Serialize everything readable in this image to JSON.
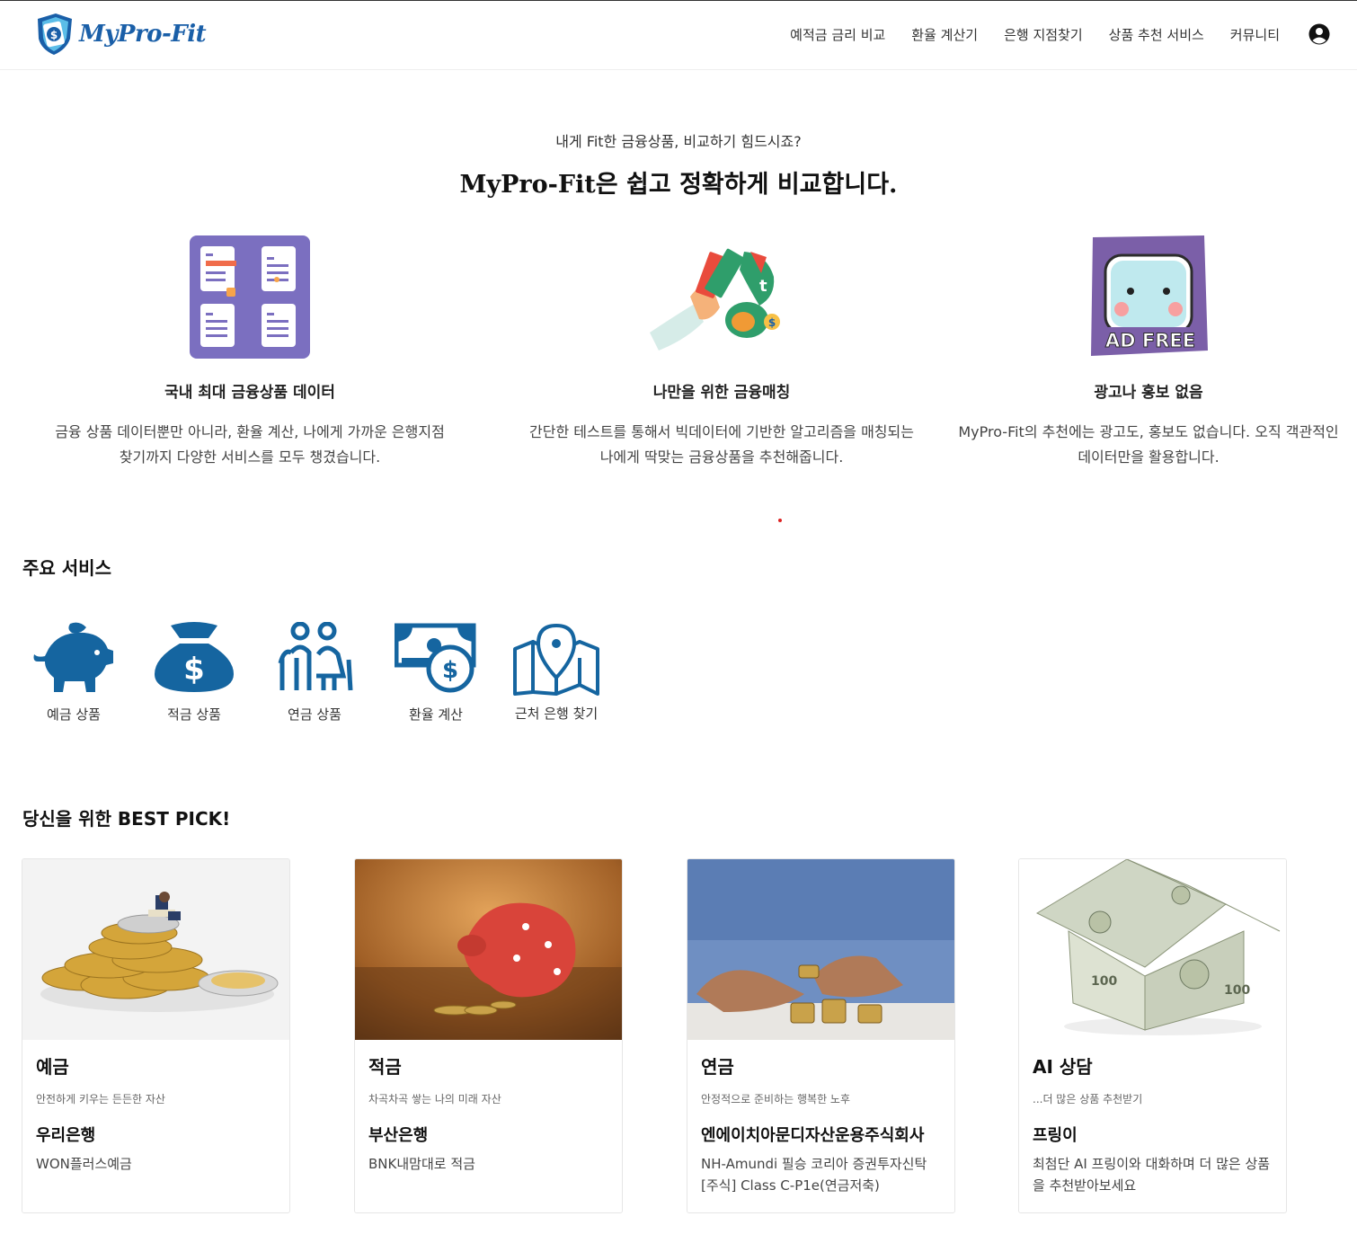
{
  "header": {
    "logo_text": "MyPro-Fit",
    "nav": [
      "예적금 금리 비교",
      "환율 계산기",
      "은행 지점찾기",
      "상품 추천 서비스",
      "커뮤니티"
    ],
    "user_icon": "user-circle-icon"
  },
  "hero": {
    "subtitle": "내게 Fit한 금융상품, 비교하기 힘드시죠?",
    "title": "MyPro-Fit은 쉽고 정확하게 비교합니다."
  },
  "features": [
    {
      "icon": "documents-icon",
      "title": "국내 최대 금융상품 데이터",
      "desc": "금융 상품 데이터뿐만 아니라, 환율 계산, 나에게 가까운 은행지점 찾기까지 다양한 서비스를 모두 챙겼습니다."
    },
    {
      "icon": "money-matching-icon",
      "title": "나만을 위한 금융매칭",
      "desc": "간단한 테스트를 통해서 빅데이터에 기반한 알고리즘을 매칭되는 나에게 딱맞는 금융상품을 추천해줍니다."
    },
    {
      "icon": "ad-free-icon",
      "badge": "AD FREE",
      "title": "광고나 홍보 없음",
      "desc": "MyPro-Fit의 추천에는 광고도, 홍보도 없습니다. 오직 객관적인 데이터만을 활용합니다."
    }
  ],
  "services_section": {
    "title": "주요 서비스",
    "items": [
      {
        "label": "예금 상품",
        "icon": "piggy-bank-icon"
      },
      {
        "label": "적금 상품",
        "icon": "money-bag-icon"
      },
      {
        "label": "연금 상품",
        "icon": "elderly-couple-icon"
      },
      {
        "label": "환율 계산",
        "icon": "banknote-icon"
      },
      {
        "label": "근처 은행 찾기",
        "icon": "map-pin-icon"
      }
    ]
  },
  "best_pick": {
    "title": "당신을 위한 BEST PICK!",
    "cards": [
      {
        "category": "예금",
        "tagline": "안전하게 키우는 든든한 자산",
        "bank": "우리은행",
        "product": "WON플러스예금"
      },
      {
        "category": "적금",
        "tagline": "차곡차곡 쌓는 나의 미래 자산",
        "bank": "부산은행",
        "product": "BNK내맘대로 적금"
      },
      {
        "category": "연금",
        "tagline": "안정적으로 준비하는 행복한 노후",
        "bank": "엔에이치아문디자산운용주식회사",
        "product": "NH-Amundi 필승 코리아 증권투자신탁[주식] Class C-P1e(연금저축)"
      },
      {
        "category": "AI 상담",
        "tagline": "...더 많은 상품 추천받기",
        "bank": "프링이",
        "product": "최첨단 AI 프링이와 대화하며 더 많은 상품을 추천받아보세요"
      }
    ]
  },
  "colors": {
    "brand": "#1a5fa8",
    "service_icon": "#1565a0",
    "feature_purple": "#7b6fc0"
  }
}
